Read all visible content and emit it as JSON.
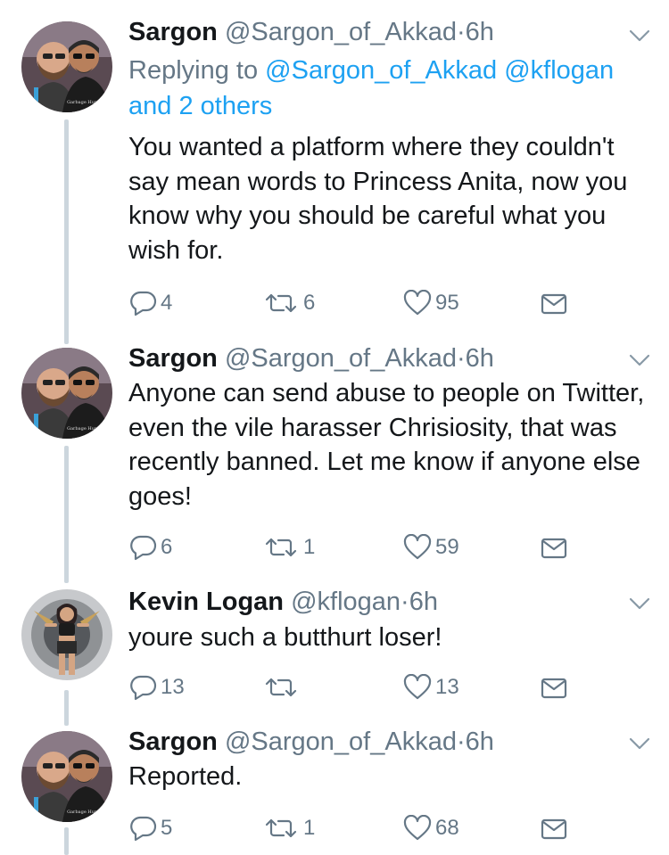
{
  "tweets": [
    {
      "name": "Sargon",
      "handle": "@Sargon_of_Akkad",
      "separator": "·",
      "time": "6h",
      "avatar": "sargon-avatar",
      "replying_prefix": "Replying to",
      "replying_mentions": [
        "@Sargon_of_Akkad",
        "@kflogan"
      ],
      "replying_suffix": "and 2 others",
      "text": "You wanted a platform where they couldn't say mean words to Princess Anita, now you know why you should be careful what you wish for.",
      "replies": "4",
      "retweets": "6",
      "likes": "95"
    },
    {
      "name": "Sargon",
      "handle": "@Sargon_of_Akkad",
      "separator": "·",
      "time": "6h",
      "avatar": "sargon-avatar",
      "text": "Anyone can send abuse to people on Twitter, even the vile harasser Chrisiosity, that was recently banned. Let me know if anyone else goes!",
      "replies": "6",
      "retweets": "1",
      "likes": "59"
    },
    {
      "name": "Kevin Logan",
      "handle": "@kflogan",
      "separator": "·",
      "time": "6h",
      "avatar": "kevin-avatar",
      "text": "youre such a butthurt loser!",
      "replies": "13",
      "retweets": "",
      "likes": "13"
    },
    {
      "name": "Sargon",
      "handle": "@Sargon_of_Akkad",
      "separator": "·",
      "time": "6h",
      "avatar": "sargon-avatar",
      "text": "Reported.",
      "replies": "5",
      "retweets": "1",
      "likes": "68"
    }
  ],
  "icons": {
    "reply": "reply-icon",
    "retweet": "retweet-icon",
    "like": "heart-icon",
    "dm": "envelope-icon",
    "more": "chevron-down-icon"
  },
  "colors": {
    "text": "#14171a",
    "muted": "#657786",
    "link": "#1da1f2",
    "thread_line": "#ccd6dd"
  }
}
